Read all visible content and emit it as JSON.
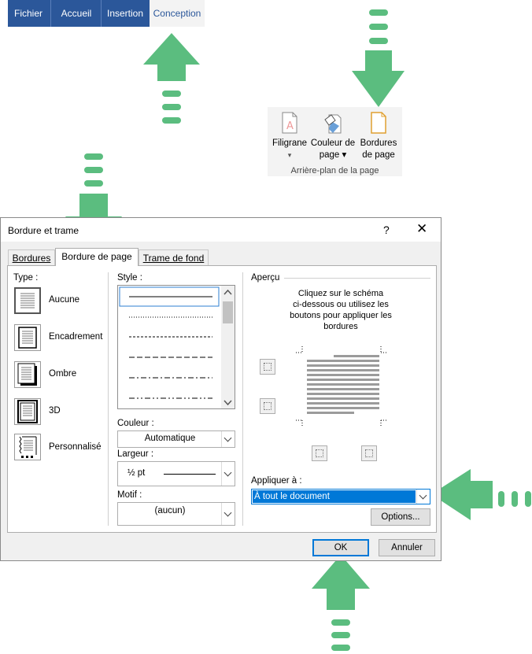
{
  "ribbon": {
    "tabs": [
      {
        "label": "Fichier",
        "active": false
      },
      {
        "label": "Accueil",
        "active": false
      },
      {
        "label": "Insertion",
        "active": false
      },
      {
        "label": "Conception",
        "active": true
      }
    ],
    "group": {
      "buttons": [
        {
          "line1": "Filigrane",
          "line2": "▾"
        },
        {
          "line1": "Couleur de",
          "line2": "page ▾"
        },
        {
          "line1": "Bordures",
          "line2": "de page"
        }
      ],
      "label": "Arrière-plan de la page"
    }
  },
  "dialog": {
    "title": "Bordure et trame",
    "help": "?",
    "close": "✕",
    "tabs": [
      {
        "label": "Bordures",
        "active": false
      },
      {
        "label": "Bordure de page",
        "active": true
      },
      {
        "label": "Trame de fond",
        "active": false
      }
    ],
    "type": {
      "label": "Type :",
      "options": [
        "Aucune",
        "Encadrement",
        "Ombre",
        "3D",
        "Personnalisé"
      ]
    },
    "style": {
      "label": "Style :"
    },
    "couleur": {
      "label": "Couleur :",
      "value": "Automatique"
    },
    "largeur": {
      "label": "Largeur :",
      "value": "½ pt"
    },
    "motif": {
      "label": "Motif :",
      "value": "(aucun)"
    },
    "apercu": {
      "label": "Aperçu",
      "instructions": [
        "Cliquez sur le schéma",
        "ci-dessous ou utilisez les",
        "boutons pour appliquer les",
        "bordures"
      ]
    },
    "appliquer": {
      "label": "Appliquer à :",
      "value": "À tout le document"
    },
    "options_button": "Options...",
    "ok_button": "OK",
    "cancel_button": "Annuler"
  },
  "colors": {
    "accent": "#2b579a",
    "arrow": "#5bbd7f",
    "selection": "#0078d7"
  }
}
